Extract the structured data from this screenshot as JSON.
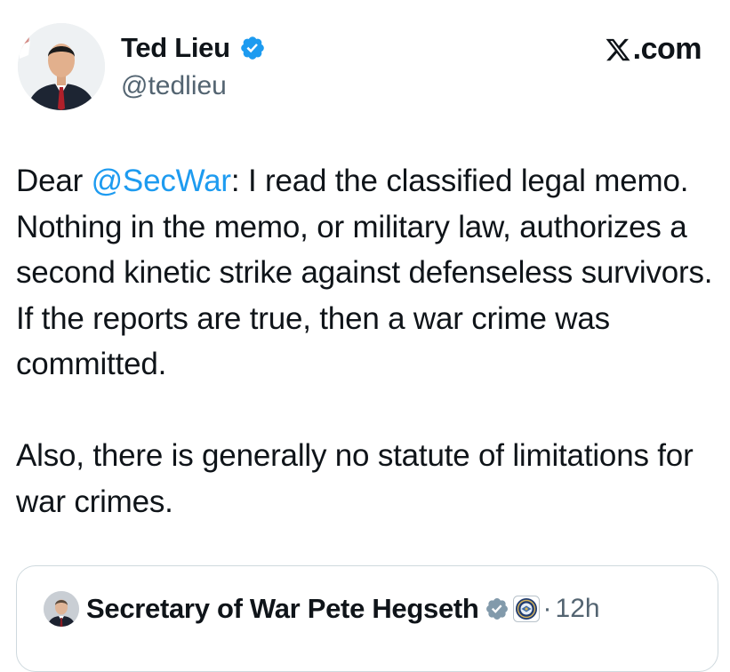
{
  "author": {
    "display_name": "Ted Lieu",
    "handle": "@tedlieu",
    "verified_icon": "blue-verified-badge"
  },
  "brand": {
    "logo_icon": "x-logo",
    "suffix": ".com"
  },
  "tweet": {
    "paragraph_1": {
      "prefix": "Dear ",
      "mention": "@SecWar",
      "text": ": I read the classified legal memo. Nothing in the memo, or military law, authorizes a second kinetic strike against defenseless survivors. If the reports are true, then a war crime was committed."
    },
    "paragraph_2": "Also, there is generally no statute of limitations for war crimes.",
    "mention_color": "#1d9bf0"
  },
  "quoted_tweet": {
    "display_name": "Secretary of War Pete Hegseth",
    "verified_icon": "gray-verified-badge",
    "affiliation_icon": "department-seal-icon",
    "separator": "·",
    "time": "12h"
  },
  "colors": {
    "verified_blue": "#1d9bf0",
    "verified_gray": "#829aab",
    "secondary_text": "#536471",
    "border": "#cfd9de"
  }
}
